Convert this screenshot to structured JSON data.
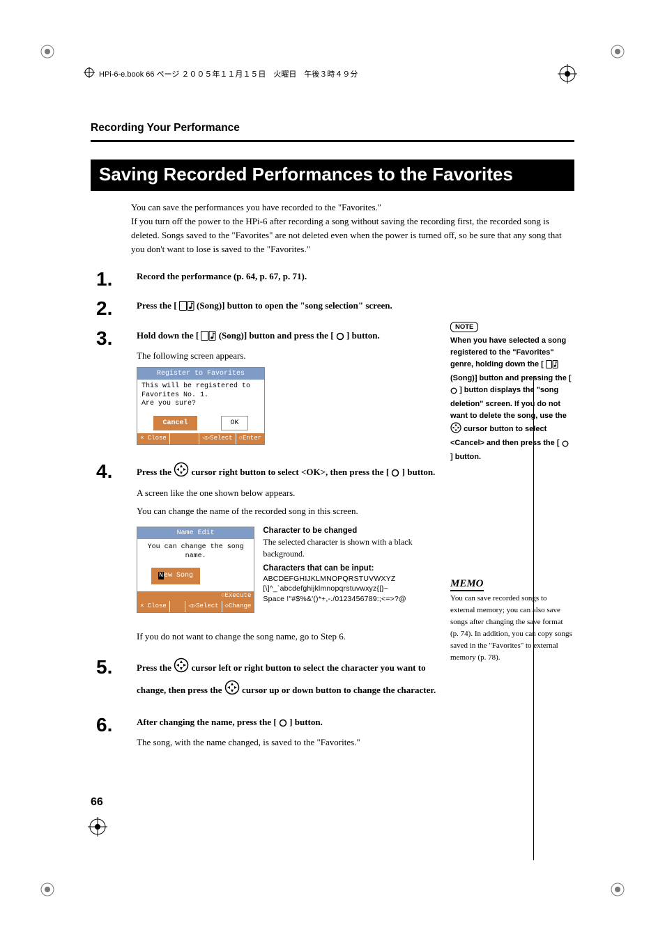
{
  "print_header": "HPi-6-e.book  66 ページ   ２００５年１１月１５日　火曜日　午後３時４９分",
  "running_head": "Recording Your Performance",
  "title": "Saving Recorded Performances to the Favorites",
  "intro": [
    "You can save the performances you have recorded to the \"Favorites.\"",
    "If you turn off the power to the HPi-6 after recording a song without saving the recording first, the recorded song is deleted. Songs saved to the \"Favorites\" are not deleted even when the power is turned off, so be sure that any song that you don't want to lose is saved to the \"Favorites.\""
  ],
  "steps": {
    "s1": {
      "num": "1.",
      "instruction": "Record the performance (p. 64, p. 67, p. 71)."
    },
    "s2": {
      "num": "2.",
      "pre": "Press the [ ",
      "post": " (Song)] button to open the \"song selection\" screen."
    },
    "s3": {
      "num": "3.",
      "pre": "Hold down the [ ",
      "mid": " (Song)] button and press the [ ",
      "post": " ] button.",
      "follow": "The following screen appears."
    },
    "s4": {
      "num": "4.",
      "pre": "Press the ",
      "mid": " cursor right button to select <OK>, then press the [ ",
      "post": " ] button.",
      "line1": "A screen like the one shown below appears.",
      "line2": "You can change the name of the recorded song in this screen.",
      "after": "If you do not want to change the song name, go to Step 6."
    },
    "s5": {
      "num": "5.",
      "pre": "Press the ",
      "mid1": " cursor left or right button to select the character you want to change, then press the ",
      "post": " cursor up or down button to change the character."
    },
    "s6": {
      "num": "6.",
      "pre": "After changing the name, press the [ ",
      "post": " ] button.",
      "follow": "The song, with the name changed, is saved to the \"Favorites.\""
    }
  },
  "lcd1": {
    "title": "Register to Favorites",
    "body1": "This will be registered to",
    "body2": "Favorites No. 1.",
    "body3": "Are you sure?",
    "btn_cancel": "Cancel",
    "btn_ok": "OK",
    "foot_close": "× Close",
    "foot_select": "◁▷Select",
    "foot_enter": "○Enter"
  },
  "lcd2": {
    "title": "Name Edit",
    "prompt": "You can change the song name.",
    "name": "New Song",
    "exec": "○Execute",
    "foot_close": "× Close",
    "foot_select": "◁▷Select",
    "foot_change": "◇Change"
  },
  "char_explain": {
    "h1": "Character to be changed",
    "p1": "The selected character is shown with a black background.",
    "h2": "Characters that can be input:",
    "line1": "ABCDEFGHIJKLMNOPQRSTUVWXYZ",
    "line2": "[\\]^_`abcdefghijklmnopqrstuvwxyz{|}~",
    "line3": "Space !\"#$%&'()*+,-./0123456789:;<=>?@"
  },
  "note": {
    "label": "NOTE",
    "text_pre": "When you have selected a song registered to the \"Favorites\" genre, holding down the [ ",
    "text_mid1": " (Song)] button and pressing the [ ",
    "text_mid2": " ] button displays the \"song deletion\" screen. If you do not want to delete the song, use the ",
    "text_mid3": " cursor button to select <Cancel> and then press the [ ",
    "text_post": " ] button."
  },
  "memo": {
    "label": "MEMO",
    "text": "You can save recorded songs to external memory; you can also save songs after changing the save format (p. 74). In addition, you can copy songs saved in the \"Favorites\" to external memory (p. 78)."
  },
  "page_number": "66"
}
